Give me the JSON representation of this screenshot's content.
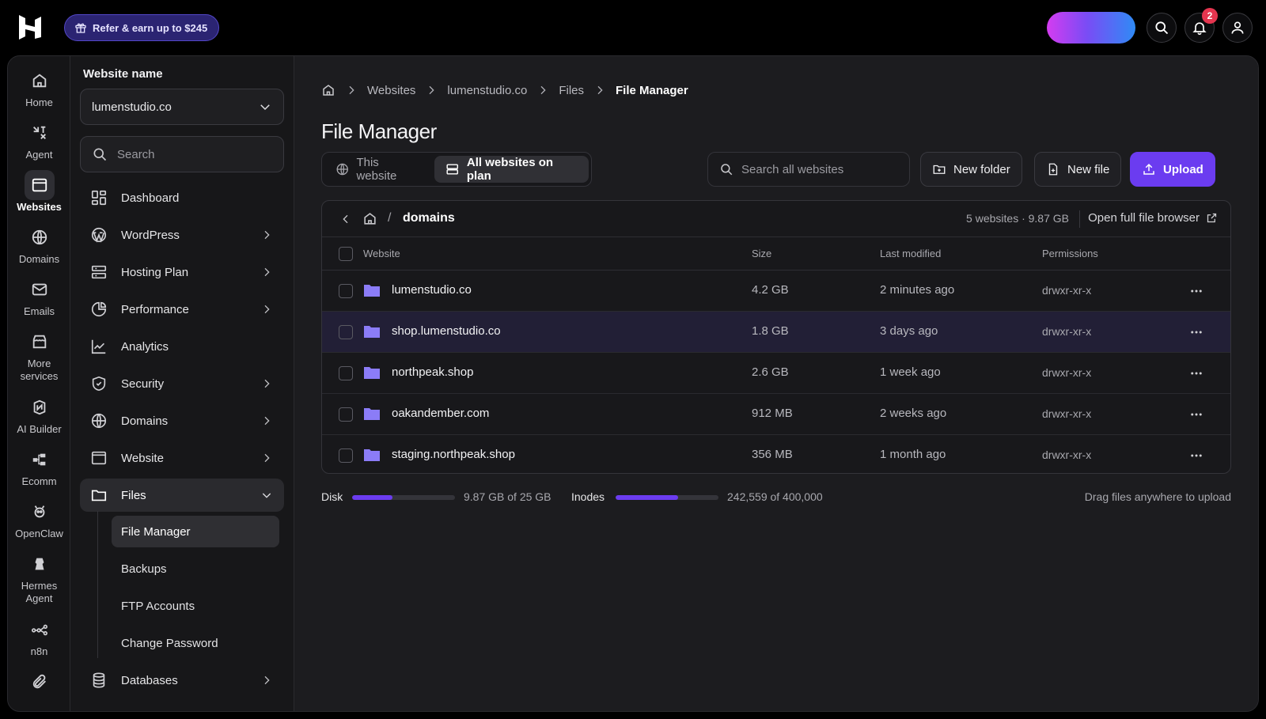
{
  "topbar": {
    "refer_label": "Refer & earn up to $245",
    "notification_count": "2"
  },
  "rail": {
    "items": [
      {
        "label": "Home",
        "icon": "home-icon"
      },
      {
        "label": "Agent",
        "icon": "agent-icon"
      },
      {
        "label": "Websites",
        "icon": "websites-icon"
      },
      {
        "label": "Domains",
        "icon": "globe-icon"
      },
      {
        "label": "Emails",
        "icon": "mail-icon"
      },
      {
        "label": "More services",
        "icon": "store-icon"
      },
      {
        "label": "AI Builder",
        "icon": "ai-builder-icon"
      },
      {
        "label": "Ecomm",
        "icon": "ecomm-icon"
      },
      {
        "label": "OpenClaw",
        "icon": "openclaw-icon"
      },
      {
        "label": "Hermes Agent",
        "icon": "hermes-icon"
      },
      {
        "label": "n8n",
        "icon": "n8n-icon"
      }
    ],
    "active": "Websites"
  },
  "sidebar": {
    "title": "Website name",
    "selected_website": "lumenstudio.co",
    "search_placeholder": "Search",
    "items": [
      {
        "label": "Dashboard"
      },
      {
        "label": "WordPress"
      },
      {
        "label": "Hosting Plan"
      },
      {
        "label": "Performance"
      },
      {
        "label": "Analytics"
      },
      {
        "label": "Security"
      },
      {
        "label": "Domains"
      },
      {
        "label": "Website"
      },
      {
        "label": "Files"
      },
      {
        "label": "Databases"
      }
    ],
    "files_sub": [
      {
        "label": "File Manager"
      },
      {
        "label": "Backups"
      },
      {
        "label": "FTP Accounts"
      },
      {
        "label": "Change Password"
      }
    ]
  },
  "main": {
    "breadcrumb": [
      "Websites",
      "lumenstudio.co",
      "Files",
      "File Manager"
    ],
    "title": "File Manager",
    "scope_tabs": [
      "This website",
      "All websites on plan"
    ],
    "search_placeholder": "Search all websites",
    "new_folder": "New folder",
    "new_file": "New file",
    "upload": "Upload",
    "browser": {
      "path": "domains",
      "summary": "5 websites · 9.87 GB",
      "open_full": "Open full file browser",
      "columns": [
        "Website",
        "Size",
        "Last modified",
        "Permissions"
      ],
      "rows": [
        {
          "name": "lumenstudio.co",
          "size": "4.2 GB",
          "modified": "2 minutes ago",
          "perm": "drwxr-xr-x"
        },
        {
          "name": "shop.lumenstudio.co",
          "size": "1.8 GB",
          "modified": "3 days ago",
          "perm": "drwxr-xr-x"
        },
        {
          "name": "northpeak.shop",
          "size": "2.6 GB",
          "modified": "1 week ago",
          "perm": "drwxr-xr-x"
        },
        {
          "name": "oakandember.com",
          "size": "912 MB",
          "modified": "2 weeks ago",
          "perm": "drwxr-xr-x"
        },
        {
          "name": "staging.northpeak.shop",
          "size": "356 MB",
          "modified": "1 month ago",
          "perm": "drwxr-xr-x"
        }
      ]
    },
    "stats": {
      "disk_label": "Disk",
      "disk_value": "9.87 GB of 25 GB",
      "disk_fraction": 0.39,
      "inodes_label": "Inodes",
      "inodes_value": "242,559 of 400,000",
      "inodes_fraction": 0.61,
      "drag_hint": "Drag files anywhere to upload"
    }
  },
  "colors": {
    "accent": "#6b3cf0",
    "folder": "#8b7cf7",
    "row_highlight": "#221f36"
  }
}
